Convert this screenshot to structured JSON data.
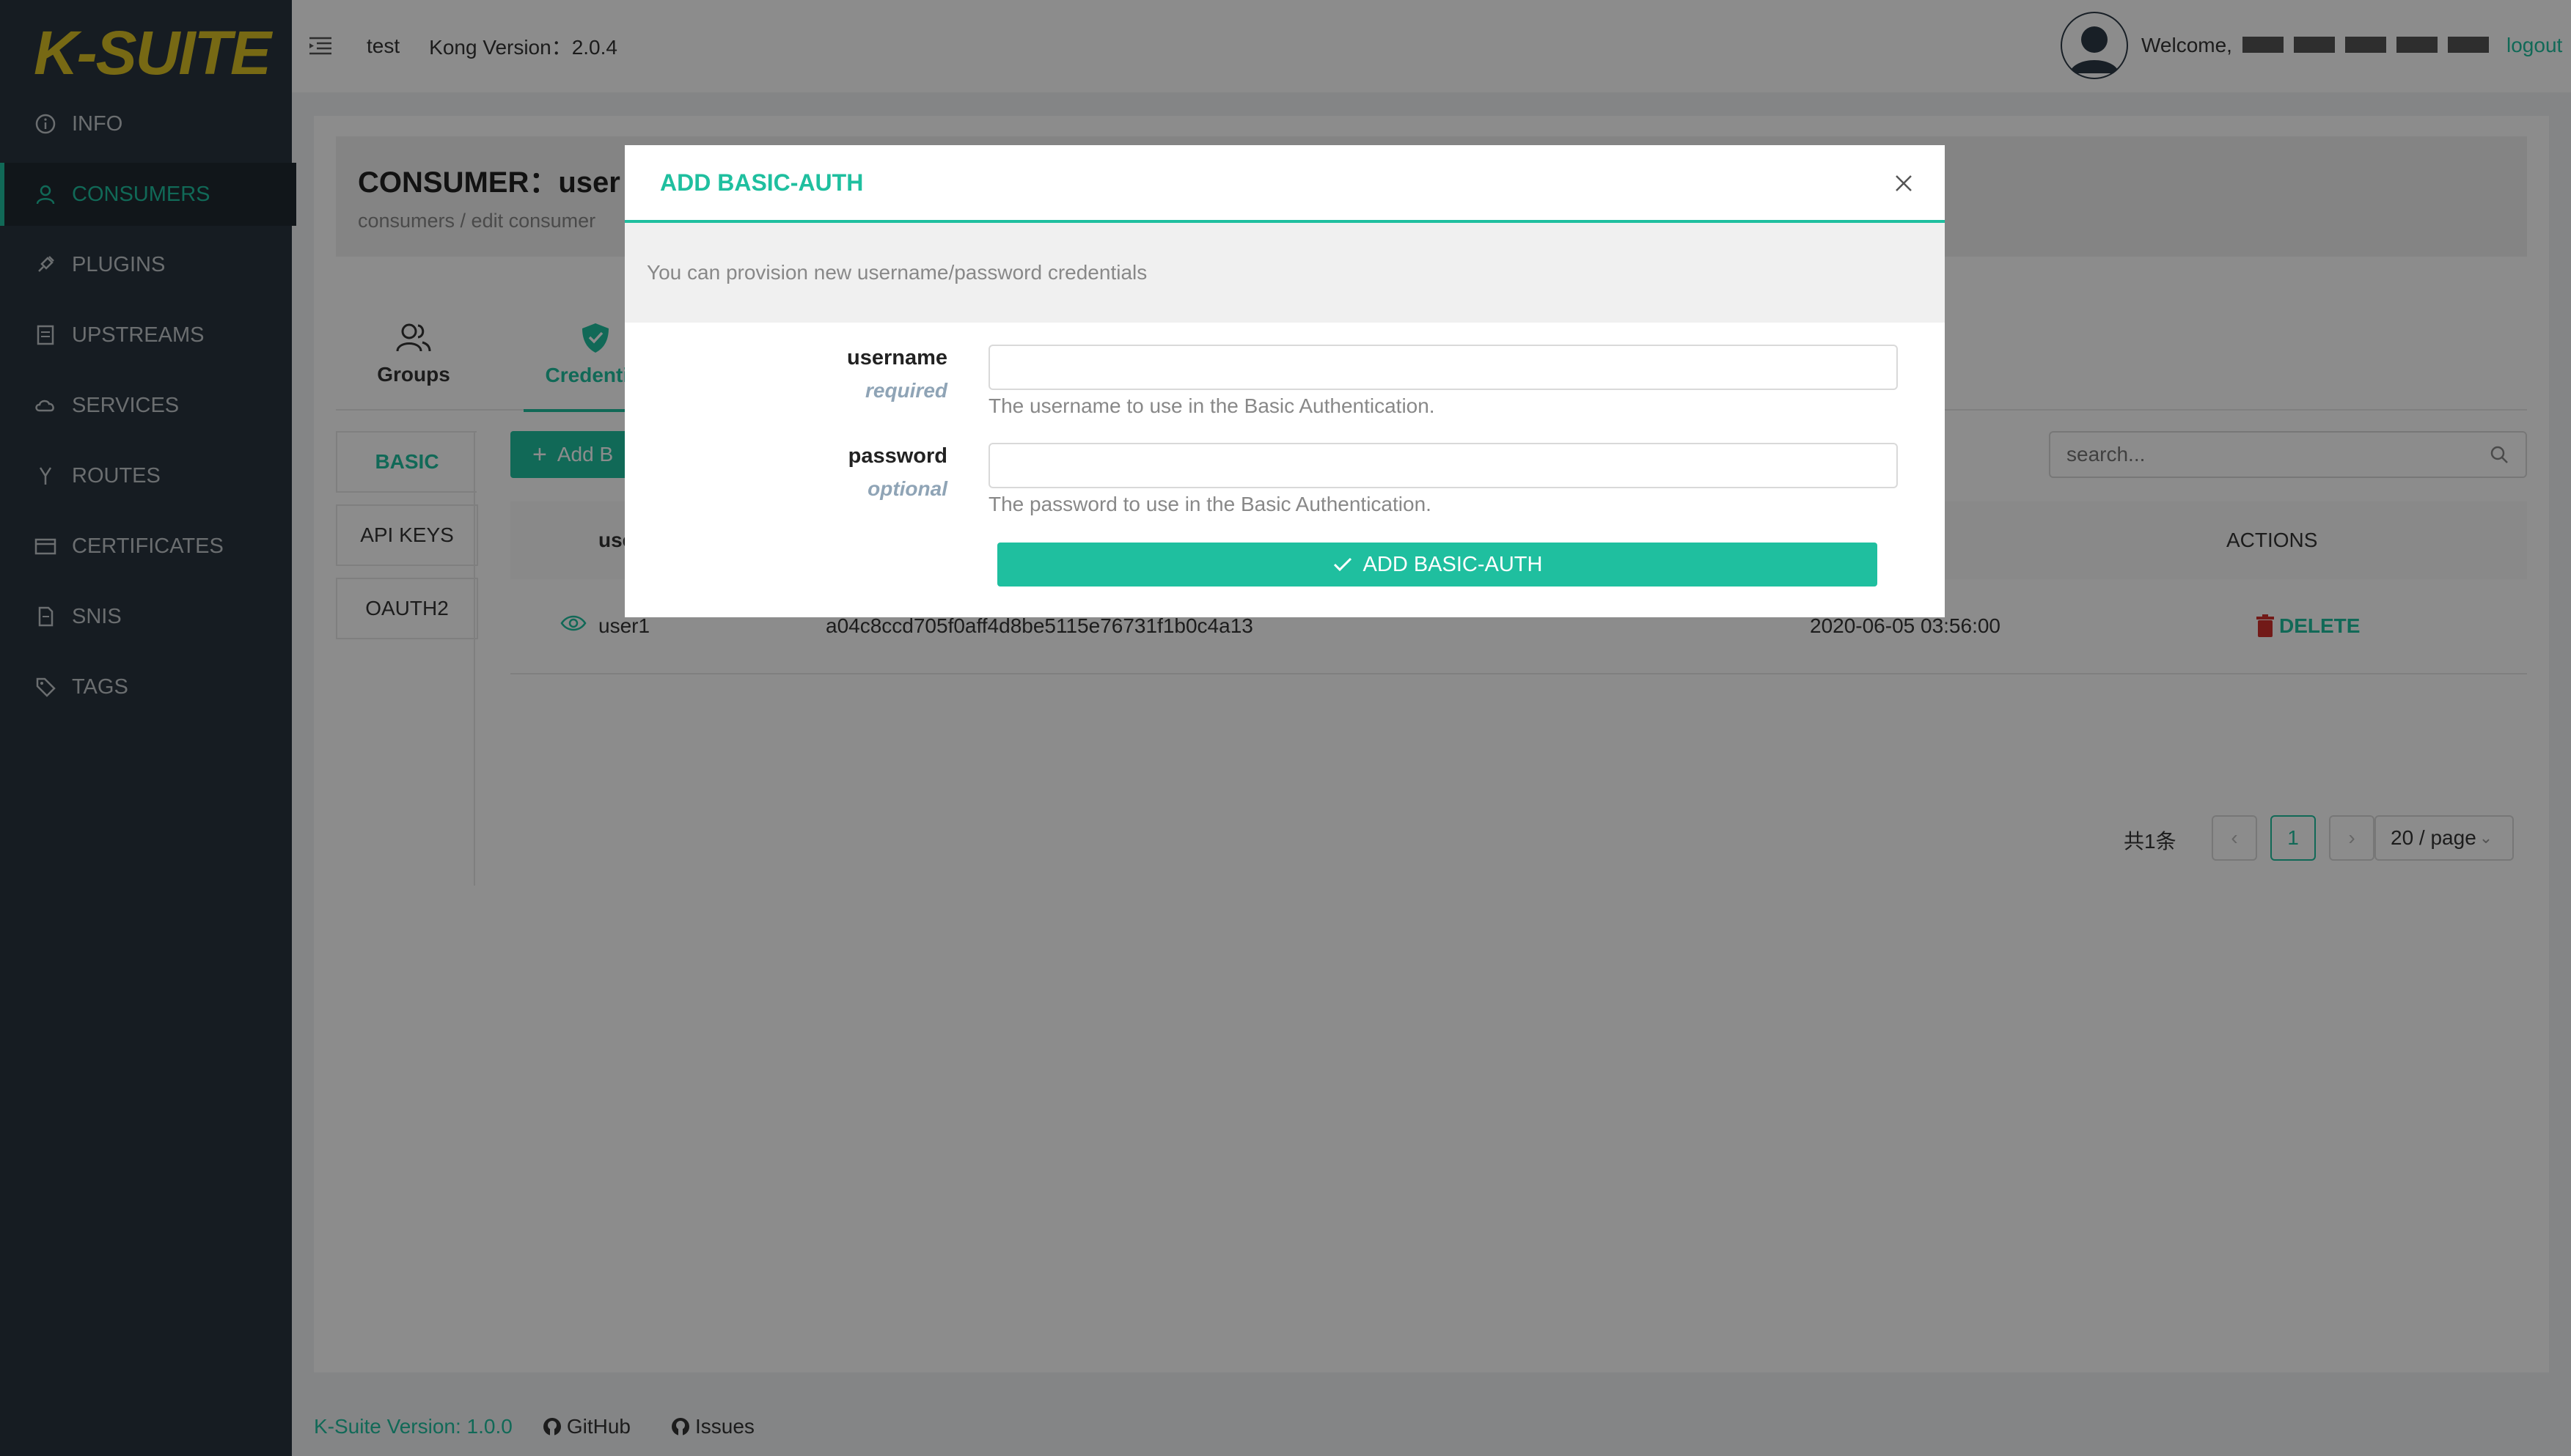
{
  "app": {
    "logo": "K-SUITE"
  },
  "sidebar": {
    "items": [
      {
        "label": "INFO",
        "icon": "info-icon"
      },
      {
        "label": "CONSUMERS",
        "icon": "user-icon",
        "active": true
      },
      {
        "label": "PLUGINS",
        "icon": "plug-icon"
      },
      {
        "label": "UPSTREAMS",
        "icon": "server-icon"
      },
      {
        "label": "SERVICES",
        "icon": "cloud-icon"
      },
      {
        "label": "ROUTES",
        "icon": "fork-icon"
      },
      {
        "label": "CERTIFICATES",
        "icon": "card-icon"
      },
      {
        "label": "SNIS",
        "icon": "file-icon"
      },
      {
        "label": "TAGS",
        "icon": "tag-icon"
      }
    ]
  },
  "header": {
    "env": "test",
    "kong_version": "Kong Version：2.0.4",
    "welcome": "Welcome,",
    "logout": "logout"
  },
  "page": {
    "title": "CONSUMER：user",
    "breadcrumb": "consumers / edit consumer",
    "tabs": [
      "Groups",
      "Credential"
    ],
    "side_tabs": [
      "BASIC",
      "API KEYS",
      "OAUTH2"
    ],
    "add_button": "Add B",
    "search_placeholder": "search...",
    "table": {
      "headers": {
        "username": "use",
        "actions": "ACTIONS"
      },
      "rows": [
        {
          "username": "user1",
          "password": "a04c8ccd705f0aff4d8be5115e76731f1b0c4a13",
          "created": "2020-06-05 03:56:00",
          "action": "DELETE"
        }
      ]
    },
    "pagination": {
      "total": "共1条",
      "current": "1",
      "page_size": "20 / page"
    }
  },
  "footer": {
    "version": "K-Suite Version: 1.0.0",
    "github": "GitHub",
    "issues": "Issues"
  },
  "modal": {
    "title": "ADD BASIC-AUTH",
    "description": "You can provision new username/password credentials",
    "fields": [
      {
        "label": "username",
        "qualifier": "required",
        "value": "",
        "help": "The username to use in the Basic Authentication."
      },
      {
        "label": "password",
        "qualifier": "optional",
        "value": "",
        "help": "The password to use in the Basic Authentication."
      }
    ],
    "submit": "ADD BASIC-AUTH"
  },
  "colors": {
    "accent": "#1fbf9f",
    "sidebar": "#28333e",
    "logo": "#d9c026",
    "danger": "#d0312d"
  }
}
